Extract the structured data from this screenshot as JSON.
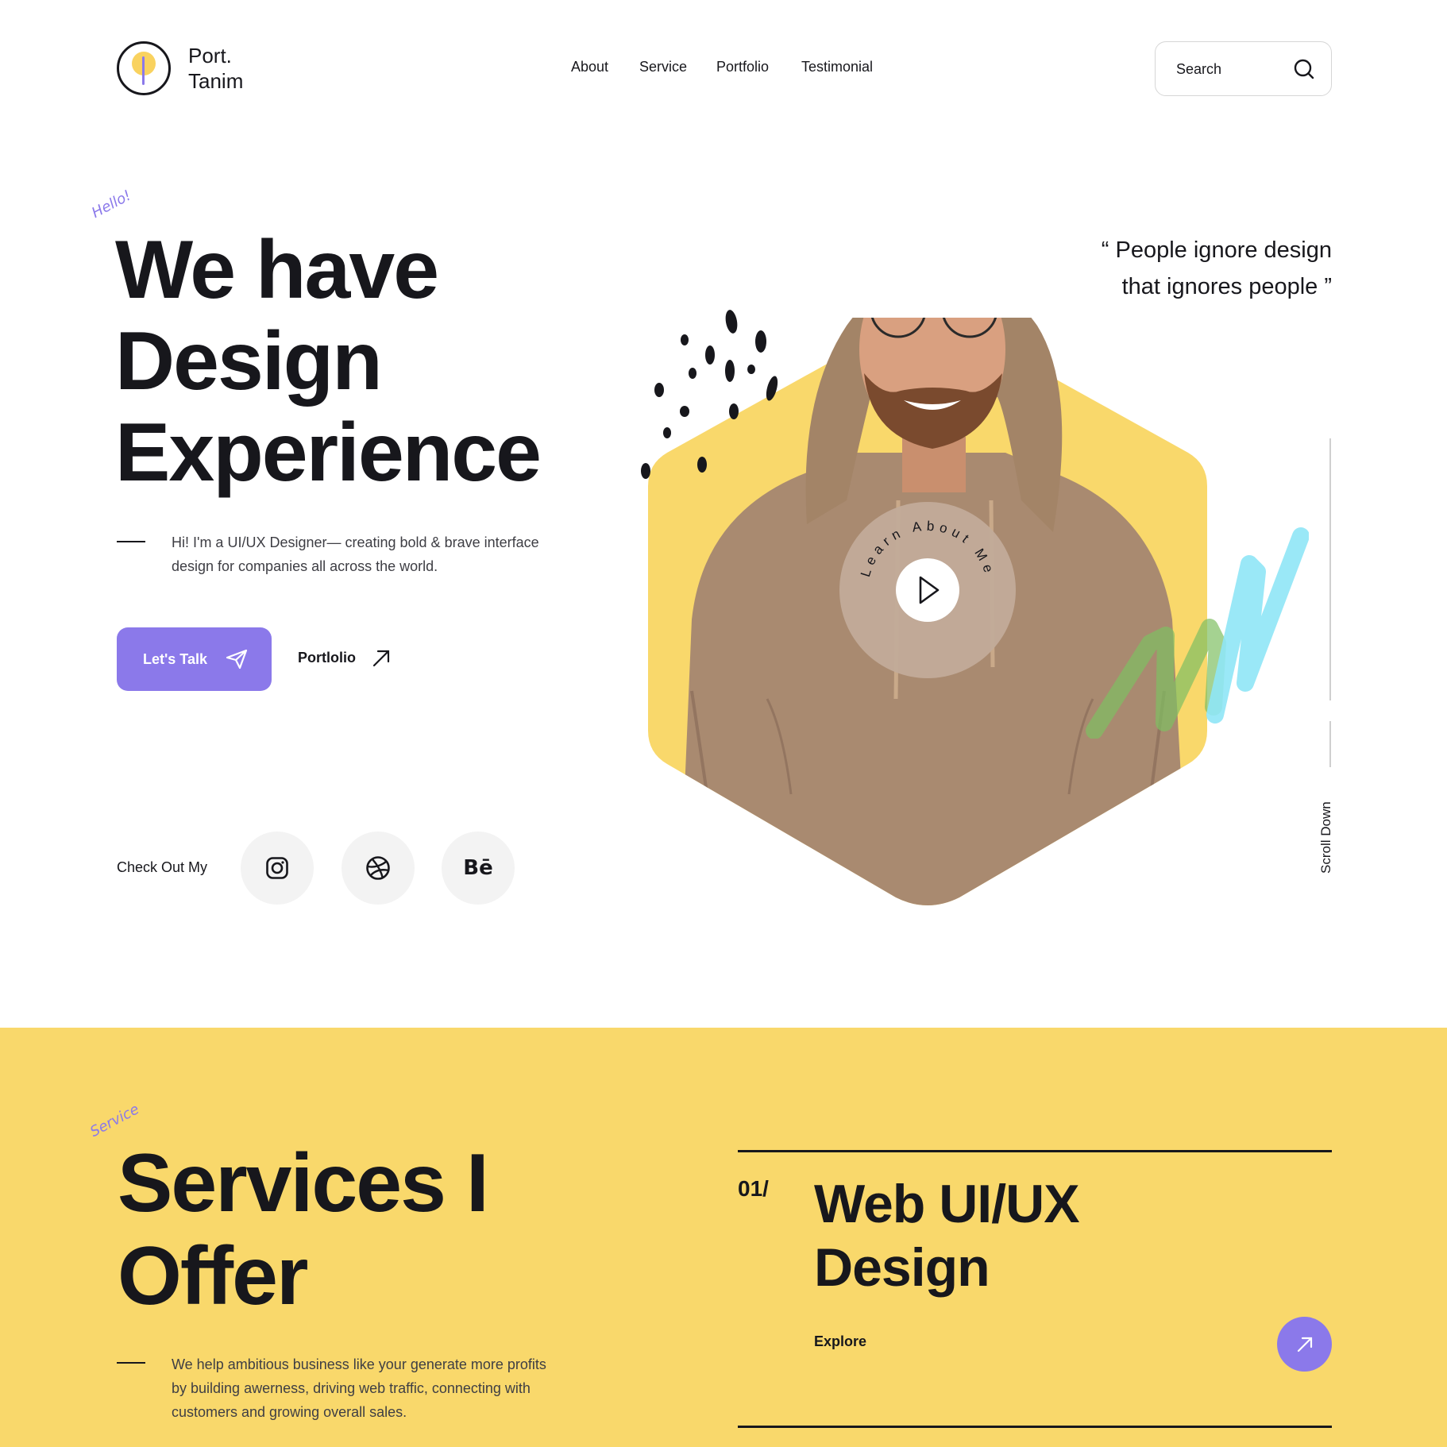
{
  "header": {
    "brand_line1": "Port.",
    "brand_line2": "Tanim",
    "nav": [
      "About",
      "Service",
      "Portfolio",
      "Testimonial"
    ],
    "search_placeholder": "Search"
  },
  "hero": {
    "tag": "Hello!",
    "title_line1": "We have",
    "title_line2": "Design",
    "title_line3": "Experience",
    "description": "Hi! I'm a UI/UX Designer— creating bold & brave interface design for companies all across the world.",
    "primary_button": "Let's Talk",
    "secondary_link": "Portlolio",
    "quote_line1": "“ People ignore design",
    "quote_line2": "that ignores people ”",
    "learn_about": "Learn About Me",
    "social_label": "Check Out My",
    "social": [
      {
        "name": "instagram-icon"
      },
      {
        "name": "dribbble-icon"
      },
      {
        "name": "behance-icon",
        "text": "Bē"
      }
    ],
    "scroll_down": "Scroll Down"
  },
  "services": {
    "tag": "Service",
    "title_line1": "Services I",
    "title_line2": "Offer",
    "description": "We help ambitious business like your generate more profits by building awerness, driving web traffic, connecting with customers and growing overall sales.",
    "item": {
      "number": "01/",
      "title_line1": "Web UI/UX",
      "title_line2": "Design",
      "link": "Explore"
    }
  },
  "colors": {
    "accent": "#8b79ea",
    "yellow": "#f9d86b",
    "text": "#17171c",
    "hoodie": "#a98a70"
  }
}
